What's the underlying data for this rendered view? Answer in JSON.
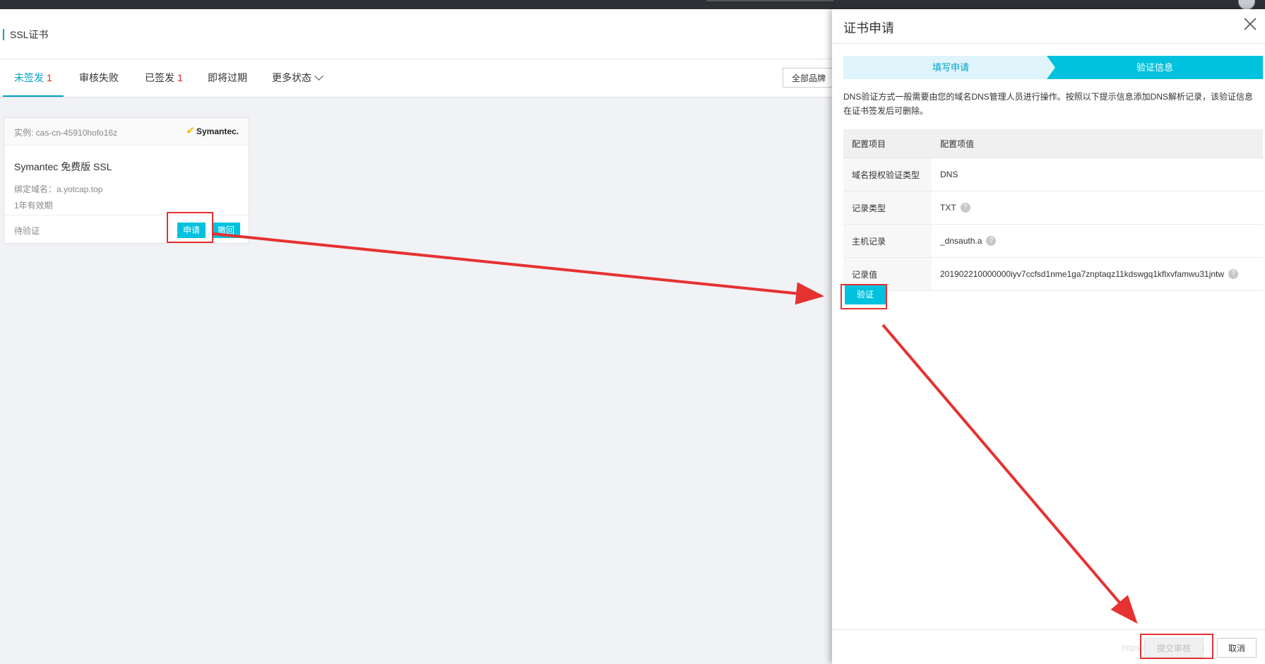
{
  "page": {
    "title": "SSL证书",
    "tabs": [
      {
        "label": "未签发",
        "count": "1"
      },
      {
        "label": "审核失败"
      },
      {
        "label": "已签发",
        "count": "1"
      },
      {
        "label": "即将过期"
      },
      {
        "label": "更多状态"
      }
    ],
    "brand_filter": "全部品牌"
  },
  "card": {
    "instance": "实例: cas-cn-45910hofo16z",
    "brand": "Symantec.",
    "product": "Symantec 免费版 SSL",
    "domain": "绑定域名：a.yotcap.top",
    "validity": "1年有效期",
    "status": "待验证",
    "apply_label": "申请",
    "revoke_label": "撤回"
  },
  "drawer": {
    "title": "证书申请",
    "steps": [
      "填写申请",
      "验证信息"
    ],
    "description": "DNS验证方式一般需要由您的域名DNS管理人员进行操作。按照以下提示信息添加DNS解析记录，该验证信息在证书签发后可删除。",
    "table": {
      "headers": [
        "配置项目",
        "配置项值"
      ],
      "rows": [
        {
          "key": "域名授权验证类型",
          "value": "DNS"
        },
        {
          "key": "记录类型",
          "value": "TXT"
        },
        {
          "key": "主机记录",
          "value": "_dnsauth.a"
        },
        {
          "key": "记录值",
          "value": "201902210000000iyv7ccfsd1nme1ga7znptaqz11kdswgq1kflxvfamwu31jntw"
        }
      ]
    },
    "verify_label": "验证",
    "submit_label": "提交审核",
    "cancel_label": "取消",
    "watermark": "https://blog.csdn.net/u..."
  },
  "colors": {
    "accent": "#00c1de",
    "link": "#00a2ca",
    "highlight": "#e63131",
    "count": "#e02020"
  }
}
